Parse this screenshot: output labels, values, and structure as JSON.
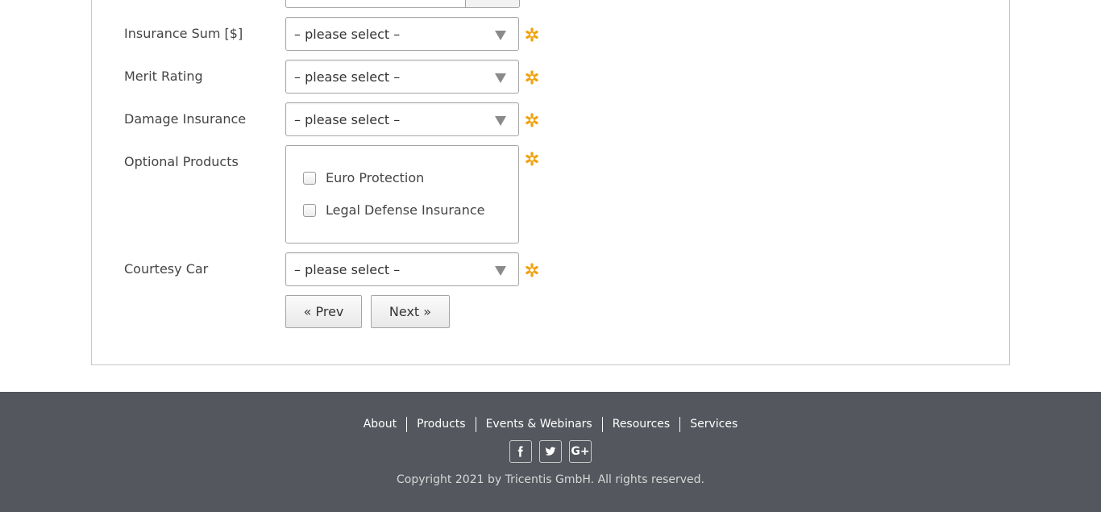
{
  "form": {
    "rows": [
      {
        "label": "Insurance Sum [$]",
        "value": "– please select –"
      },
      {
        "label": "Merit Rating",
        "value": "– please select –"
      },
      {
        "label": "Damage Insurance",
        "value": "– please select –"
      },
      {
        "label": "Optional Products"
      },
      {
        "label": "Courtesy Car",
        "value": "– please select –"
      }
    ],
    "optional_products": [
      {
        "label": "Euro Protection",
        "checked": false
      },
      {
        "label": "Legal Defense Insurance",
        "checked": false
      }
    ],
    "prev_label": "« Prev",
    "next_label": "Next »",
    "required_color": "#f0a20f"
  },
  "footer": {
    "links": [
      "About",
      "Products",
      "Events & Webinars",
      "Resources",
      "Services"
    ],
    "social": [
      {
        "icon": "facebook-icon",
        "glyph": "f"
      },
      {
        "icon": "twitter-icon",
        "glyph": "t"
      },
      {
        "icon": "google-plus-icon",
        "glyph": "G+"
      }
    ],
    "copyright": "Copyright 2021 by Tricentis GmbH. All rights reserved.",
    "background": "#54575d"
  }
}
